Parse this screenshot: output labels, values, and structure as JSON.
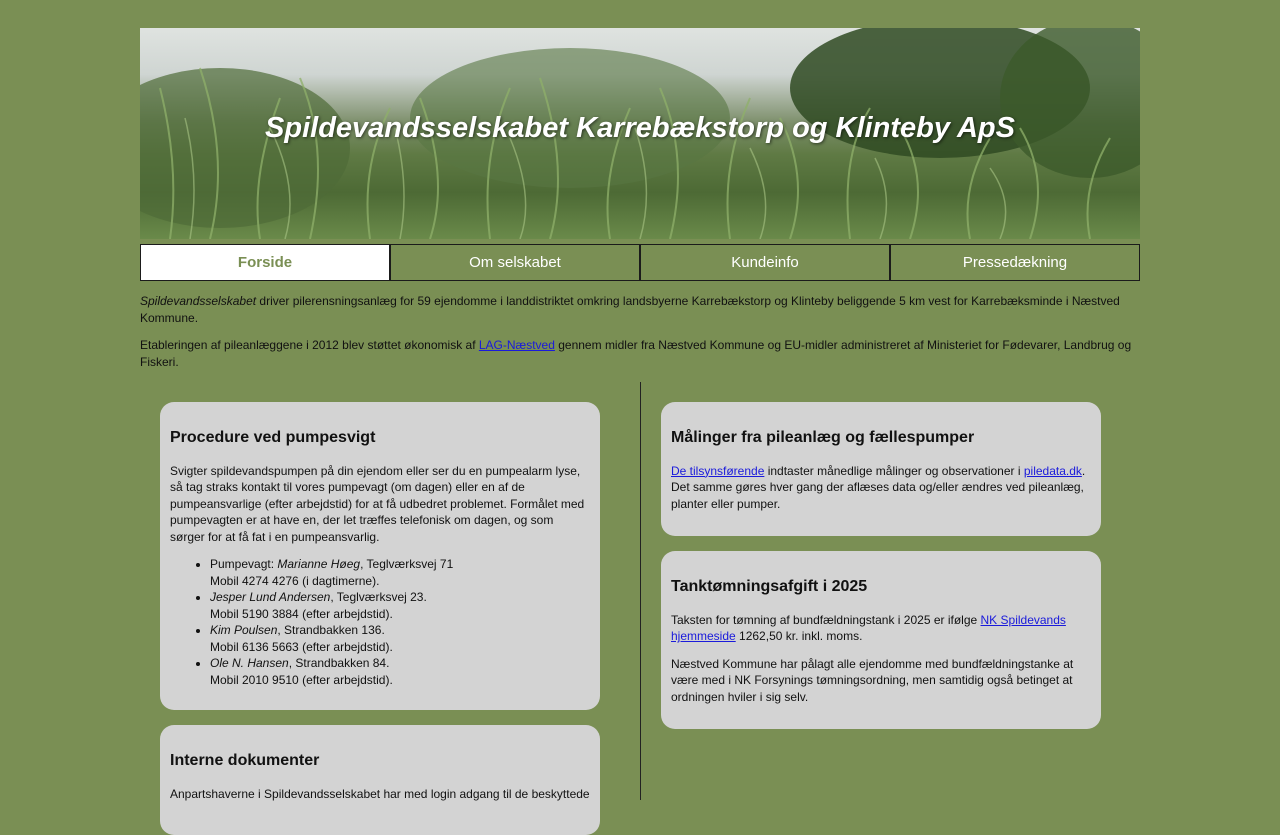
{
  "header": {
    "title": "Spildevandsselskabet Karrebækstorp og Klinteby ApS"
  },
  "nav": {
    "items": [
      {
        "label": "Forside",
        "active": true
      },
      {
        "label": "Om selskabet",
        "active": false
      },
      {
        "label": "Kundeinfo",
        "active": false
      },
      {
        "label": "Pressedækning",
        "active": false
      }
    ]
  },
  "intro": {
    "p1_company": "Spildevandsselskabet",
    "p1_text": " driver pilerensningsanlæg for 59 ejendomme i landdistriktet omkring landsbyerne Karrebækstorp og Klinteby beliggende 5 km vest for Karrebæksminde i Næstved Kommune.",
    "p2_before": "Etableringen af pileanlæggene i 2012 blev støttet økonomisk af ",
    "p2_link": "LAG-Næstved",
    "p2_after": " gennem midler fra Næstved Kommune og EU-midler administreret af Ministeriet for Fødevarer, Landbrug og Fiskeri."
  },
  "procedure": {
    "title": "Procedure ved pumpesvigt",
    "text": "Svigter spildevandspumpen på din ejendom eller ser du en pumpealarm lyse, så tag straks kontakt til vores pumpevagt (om dagen) eller en af de pumpeansvarlige (efter arbejdstid) for at få udbedret problemet. Formålet med pumpevagten er at have en, der let træffes telefonisk om dagen, og som sørger for at få fat i en pumpeansvarlig.",
    "contacts": [
      {
        "prefix": "Pumpevagt: ",
        "name": "Marianne Høeg",
        "address": ", Teglværksvej 71",
        "phone": "Mobil 4274 4276 (i dagtimerne)."
      },
      {
        "prefix": "",
        "name": "Jesper Lund Andersen",
        "address": ", Teglværksvej 23.",
        "phone": "Mobil 5190 3884 (efter arbejdstid)."
      },
      {
        "prefix": "",
        "name": "Kim Poulsen",
        "address": ", Strandbakken 136.",
        "phone": "Mobil 6136 5663 (efter arbejdstid)."
      },
      {
        "prefix": "",
        "name": "Ole N. Hansen",
        "address": ", Strandbakken 84.",
        "phone": "Mobil 2010 9510 (efter arbejdstid)."
      }
    ]
  },
  "internal": {
    "title": "Interne dokumenter",
    "text": "Anpartshaverne i Spildevandsselskabet har med login adgang til de beskyttede"
  },
  "measurements": {
    "title": "Målinger fra pileanlæg og fællespumper",
    "link1": "De tilsynsførende",
    "text1": " indtaster månedlige målinger og observationer i ",
    "link2": "piledata.dk",
    "text2": ". Det samme gøres hver gang der aflæses data og/eller ændres ved pileanlæg, planter eller pumper."
  },
  "tank": {
    "title": "Tanktømningsafgift i 2025",
    "p1_before": "Taksten for tømning af bundfældningstank i 2025 er ifølge ",
    "p1_link": "NK Spildevands hjemmeside",
    "p1_after": " 1262,50 kr. inkl. moms.",
    "p2": "Næstved Kommune har pålagt alle ejendomme med bundfældningstanke at være med i NK Forsynings tømningsordning, men samtidig også betinget at ordningen hviler i sig selv."
  }
}
